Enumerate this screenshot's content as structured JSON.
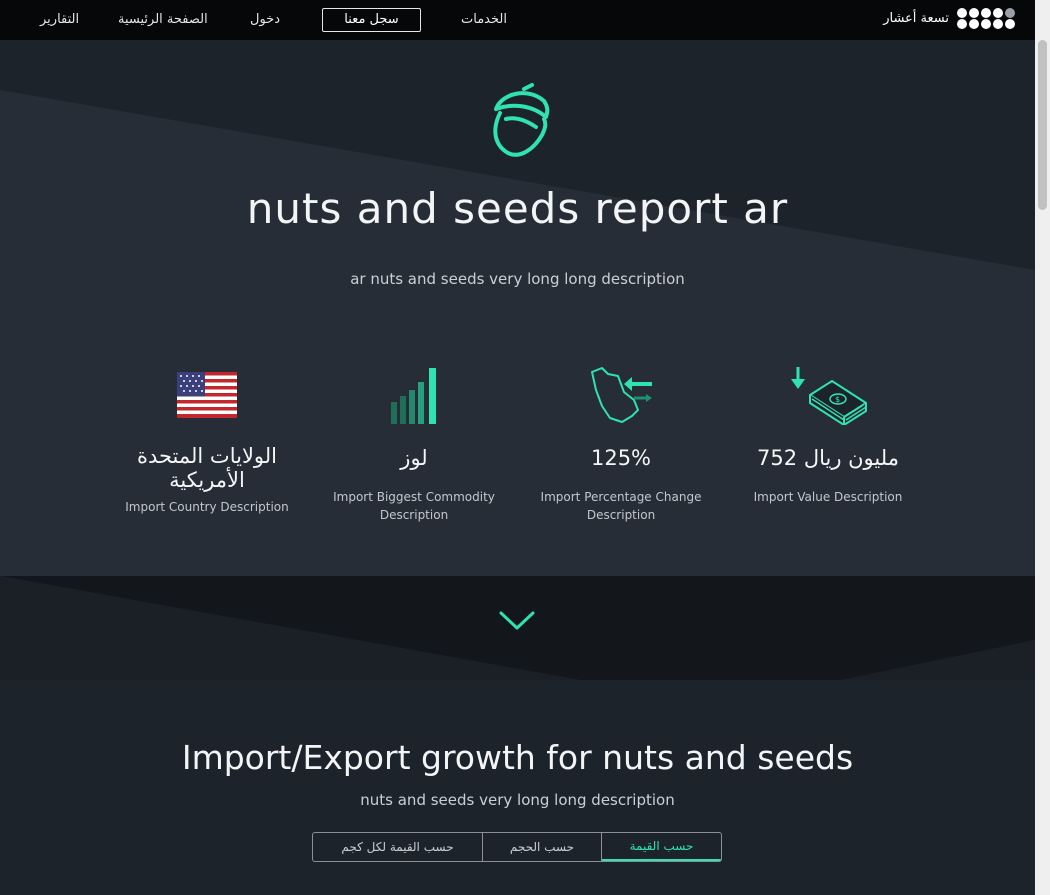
{
  "nav": {
    "reports": "التقارير",
    "home": "الصفحة الرئيسية",
    "login": "دخول",
    "register": "سجل معنا",
    "services": "الخدمات",
    "brand_name": "تسعة أعشار"
  },
  "hero": {
    "title": "nuts and seeds report ar",
    "description": "ar nuts and seeds very long long description"
  },
  "stats": [
    {
      "value": "الولايات المتحدة الأمريكية",
      "label": "Import Country Description",
      "icon": "us-flag-icon"
    },
    {
      "value": "لوز",
      "label": "Import Biggest Commodity Description",
      "icon": "bar-growth-icon"
    },
    {
      "value": "125%",
      "label": "Import Percentage Change Description",
      "icon": "map-exchange-icon"
    },
    {
      "value": "752 مليون ريال",
      "label": "Import Value Description",
      "icon": "money-stack-icon"
    }
  ],
  "growth": {
    "title": "Import/Export growth for nuts and seeds",
    "description": "nuts and seeds very long long description",
    "tabs": [
      "حسب القيمة لكل كجم",
      "حسب الحجم",
      "حسب القيمة"
    ],
    "active_tab": "حسب القيمة"
  },
  "colors": {
    "accent": "#2fe3b0",
    "nav_bg": "#050708",
    "page_bg": "#1d232b"
  }
}
